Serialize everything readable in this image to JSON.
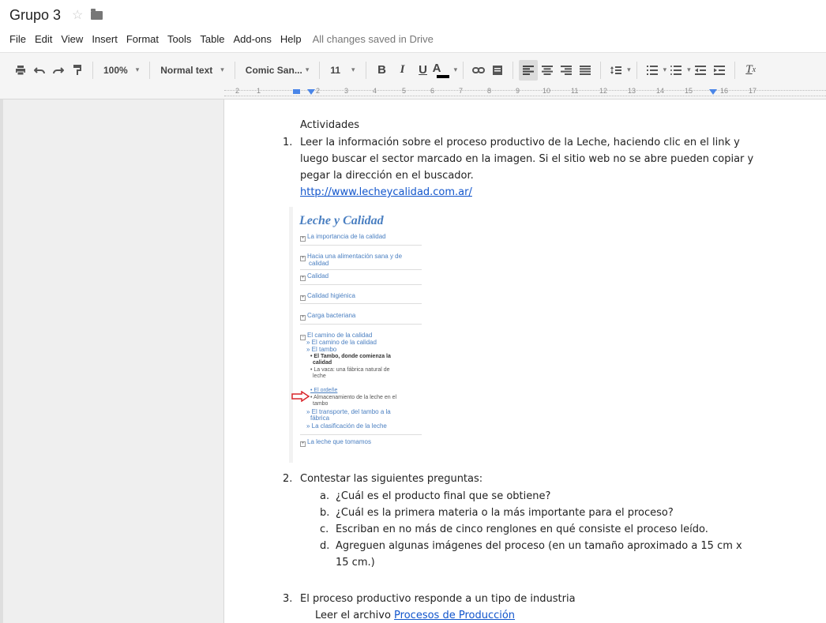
{
  "app": {
    "doc_title": "Grupo 3",
    "menu": [
      "File",
      "Edit",
      "View",
      "Insert",
      "Format",
      "Tools",
      "Table",
      "Add-ons",
      "Help"
    ],
    "save_status": "All changes saved in Drive"
  },
  "toolbar": {
    "zoom": "100%",
    "style": "Normal text",
    "font": "Comic San...",
    "font_size": "11",
    "bold": "B",
    "italic": "I",
    "underline": "U",
    "text_color": "A",
    "clear_format": "T"
  },
  "ruler": {
    "numbers": [
      "2",
      "1",
      "1",
      "2",
      "3",
      "4",
      "5",
      "6",
      "7",
      "8",
      "9",
      "10",
      "11",
      "12",
      "13",
      "14",
      "15",
      "16",
      "17"
    ]
  },
  "document": {
    "heading": "Actividades",
    "item1": {
      "num": "1.",
      "line1": "Leer la información sobre el proceso productivo de la Leche,  haciendo clic en el link y",
      "line2": "luego buscar el sector marcado en la imagen. Si el sitio web no se abre pueden copiar y",
      "line3": "pegar la dirección en el buscador.",
      "link": "http://www.lecheycalidad.com.ar/"
    },
    "embedded_image": {
      "title": "Leche y Calidad",
      "items": [
        "La importancia de la calidad",
        "Hacia una alimentación sana y de",
        "calidad",
        "Calidad",
        "Calidad higiénica",
        "Carga bacteriana",
        "El camino de la calidad",
        "La leche que tomamos"
      ],
      "sub": [
        "» El camino de la calidad",
        "» El tambo",
        "» El transporte, del tambo a la",
        "fábrica",
        "» La clasificación de la leche"
      ],
      "sub2": [
        "• El Tambo, donde comienza la",
        "calidad",
        "• La vaca: una fábrica natural de",
        "leche",
        "• El ordeñe",
        "• Almacenamiento de la leche en el",
        "tambo"
      ]
    },
    "item2": {
      "num": "2.",
      "text": "Contestar las siguientes preguntas:",
      "subs": [
        {
          "letter": "a.",
          "text": "¿Cuál es el producto final que se obtiene?"
        },
        {
          "letter": "b.",
          "text": "¿Cuál es la primera materia o la más importante para el proceso?"
        },
        {
          "letter": "c.",
          "text": "Escriban en no más de cinco renglones en qué consiste el proceso leído."
        },
        {
          "letter": "d.",
          "text": "Agreguen algunas imágenes del proceso (en un tamaño aproximado a 15 cm x"
        },
        {
          "letter": "",
          "text": "15 cm.)"
        }
      ]
    },
    "item3": {
      "num": "3.",
      "text": "El proceso productivo responde a un tipo de industria",
      "line2_prefix": "Leer el archivo ",
      "link": "Procesos de Producción"
    }
  },
  "colors": {
    "link": "#1155cc",
    "image_blue": "#4a7fc1",
    "ruler_marker": "#4a86e8"
  }
}
